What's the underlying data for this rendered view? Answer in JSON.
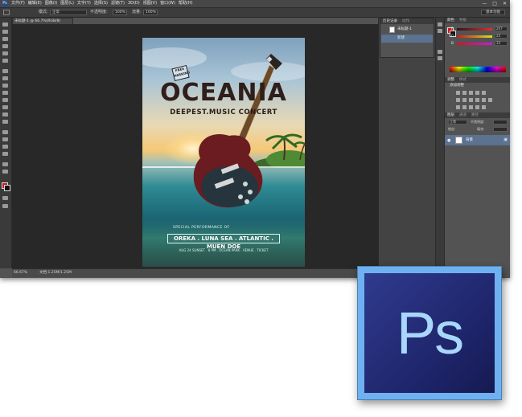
{
  "app": {
    "logo_text": "Ps",
    "menu": [
      "文件(F)",
      "编辑(E)",
      "图像(I)",
      "图层(L)",
      "文字(Y)",
      "选择(S)",
      "滤镜(T)",
      "3D(D)",
      "视图(V)",
      "窗口(W)",
      "帮助(H)"
    ],
    "window_buttons": [
      "—",
      "□",
      "✕"
    ]
  },
  "options_bar": {
    "mode_label": "模式:",
    "mode_value": "正常",
    "opacity_label": "不透明度:",
    "opacity_value": "100%",
    "flow_label": "流量:",
    "flow_value": "100%",
    "workspace": "基本功能"
  },
  "document": {
    "tab_label": "未标题-1 @ 66.7%(RGB/8)",
    "zoom": "66.67%",
    "status_text": "文档:1.25M/1.25M"
  },
  "poster": {
    "stamp": "FREE PARKING",
    "title": "OCEANIA",
    "subtitle": "DEEPEST.MUSIC CONCERT",
    "special": "SPECIAL PERFORMANCE OF",
    "artists": "OREKA . LUNA SEA . ATLANTIC . MUEN DOE",
    "details": "AUG 24 SUNSET . 8 PM . OCEAN PARK . VENUE . TICKET"
  },
  "history_panel": {
    "tabs": [
      "历史记录",
      "动作"
    ],
    "items": [
      {
        "label": "未标题-1",
        "selected": false
      },
      {
        "label": "新建",
        "selected": true
      }
    ]
  },
  "color_panel": {
    "tabs": [
      "颜色",
      "色板"
    ],
    "channels": [
      {
        "name": "R",
        "value": "207",
        "color": "#e03030"
      },
      {
        "name": "G",
        "value": "23",
        "color": "#30c030"
      },
      {
        "name": "B",
        "value": "33",
        "color": "#3050e0"
      }
    ]
  },
  "adjustments_panel": {
    "tabs": [
      "调整",
      "样式"
    ],
    "title": "添加调整"
  },
  "layers_panel": {
    "tabs": [
      "图层",
      "通道",
      "路径"
    ],
    "blend_mode": "正常",
    "opacity_label": "不透明度:",
    "lock_label": "锁定:",
    "fill_label": "填充:",
    "layer_name": "背景"
  },
  "icons": {
    "eye": "eye-icon",
    "lock": "lock-icon"
  }
}
